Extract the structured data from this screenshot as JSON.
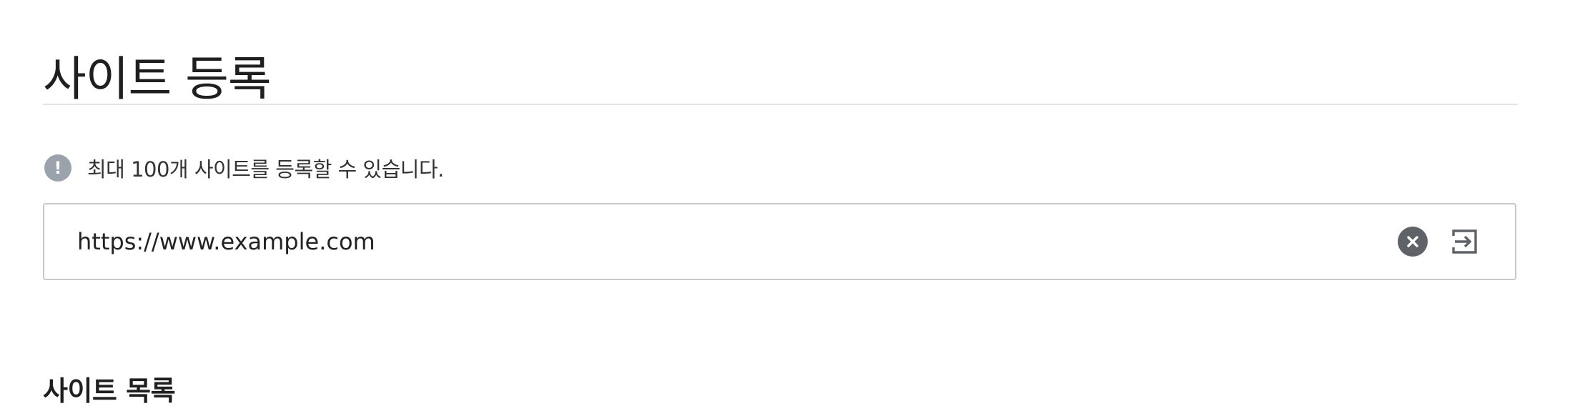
{
  "page": {
    "title": "사이트 등록"
  },
  "notice": {
    "icon": "exclamation-icon",
    "icon_glyph": "!",
    "text": "최대 100개 사이트를 등록할 수 있습니다."
  },
  "url_field": {
    "value": "https://www.example.com",
    "clear_icon": "close-circle-icon",
    "submit_icon": "enter-icon"
  },
  "site_list": {
    "title": "사이트 목록"
  },
  "colors": {
    "notice_icon_bg": "#9aa2ab",
    "clear_icon_bg": "#5f6368",
    "divider": "#e3e3e3",
    "input_border": "#c8c8c8"
  }
}
